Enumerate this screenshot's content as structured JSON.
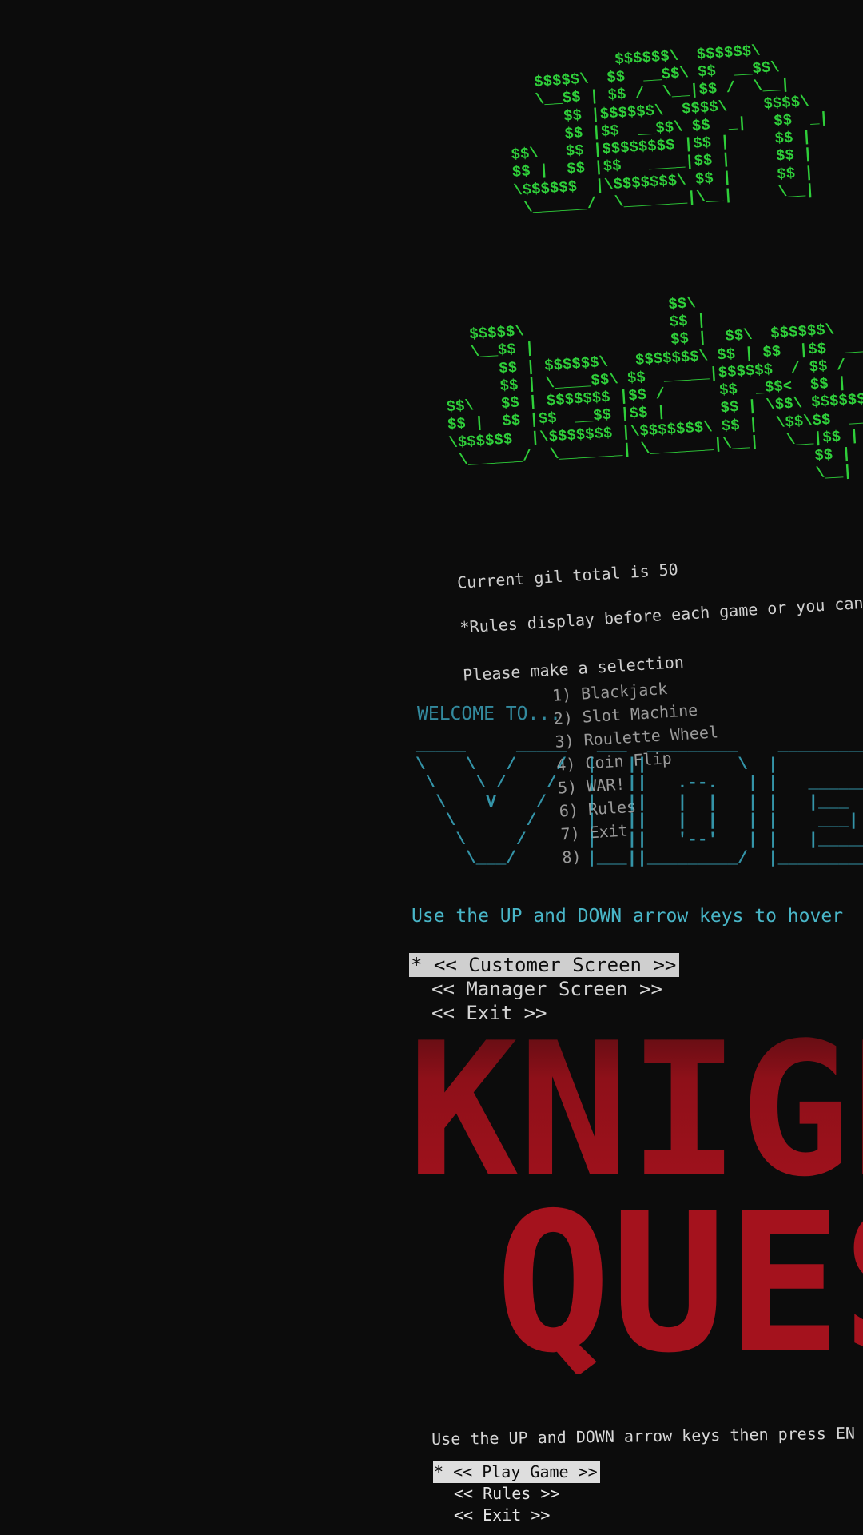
{
  "jackpot": {
    "title_art_line1": "Jeff's",
    "title_art_line2": "Jackpot",
    "gil_line": "Current gil total is 50",
    "rules_note": "*Rules display before each game or you can r",
    "prompt": "Please make a selection",
    "menu": [
      "1) Blackjack",
      "2) Slot Machine",
      "3) Roulette Wheel",
      "4) Coin Flip",
      "5) WAR!",
      "6) Rules",
      "7) Exit",
      "8)"
    ]
  },
  "video_store": {
    "welcome": "WELCOME TO...",
    "title_art": "VIDEO",
    "instructions": "Use the UP and DOWN arrow keys to hover",
    "menu": [
      {
        "label": "<< Customer Screen >>",
        "selected": true
      },
      {
        "label": "<< Manager Screen >>",
        "selected": false
      },
      {
        "label": "<< Exit >>",
        "selected": false
      }
    ],
    "selection_marker": "*"
  },
  "knight_quest": {
    "title_line1": "KNIGHT",
    "title_line2": "QUEST",
    "instructions": "Use the UP and DOWN arrow keys then press EN",
    "menu": [
      {
        "label": "<< Play Game >>",
        "selected": true
      },
      {
        "label": "<< Rules >>",
        "selected": false
      },
      {
        "label": "<< Exit >>",
        "selected": false
      }
    ],
    "selection_marker": "*"
  },
  "colors": {
    "background": "#0c0c0c",
    "ascii_green": "#2fcf3a",
    "ascii_teal": "#3fb6cf",
    "title_red": "#a4121d",
    "highlight": "#cfcfcf"
  }
}
